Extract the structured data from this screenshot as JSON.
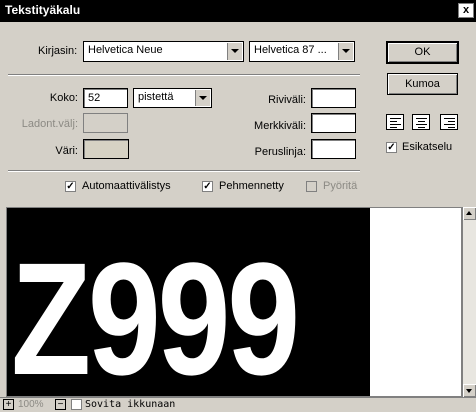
{
  "window": {
    "title": "Tekstityäkalu",
    "close_glyph": "x"
  },
  "font": {
    "label": "Kirjasin:",
    "family_value": "Helvetica Neue",
    "style_value": "Helvetica 87 ..."
  },
  "buttons": {
    "ok": "OK",
    "cancel": "Kumoa"
  },
  "size": {
    "label": "Koko:",
    "value": "52",
    "unit_value": "pistettä"
  },
  "leading": {
    "label": "Ladont.välj:"
  },
  "color": {
    "label": "Väri:",
    "swatch": "#d6d2c4"
  },
  "line_spacing": {
    "label": "Riviväli:",
    "value": ""
  },
  "char_spacing": {
    "label": "Merkkiväli:",
    "value": ""
  },
  "baseline": {
    "label": "Peruslinja:",
    "value": ""
  },
  "alignment": {
    "icons": [
      "align-left-icon",
      "align-center-icon",
      "align-right-icon"
    ]
  },
  "preview_toggle": {
    "label": "Esikatselu",
    "checked": true
  },
  "options": {
    "auto_kerning": {
      "label": "Automaattivälistys",
      "checked": true
    },
    "anti_alias": {
      "label": "Pehmennetty",
      "checked": true
    },
    "rotate": {
      "label": "Pyöritä",
      "checked": false,
      "disabled": true
    }
  },
  "preview": {
    "text": "Z999"
  },
  "bottombar": {
    "zoom_in": "+",
    "zoom_level": "100%",
    "zoom_out": "−",
    "fit_label": "Sovita ikkunaan"
  },
  "check_mark": "✓"
}
